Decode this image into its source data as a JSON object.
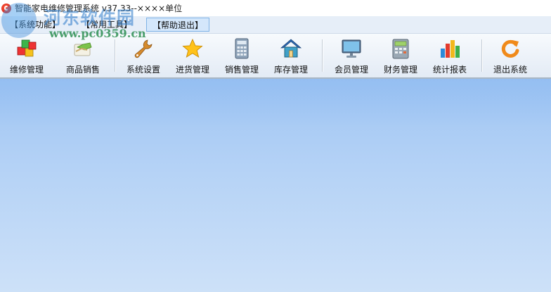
{
  "window": {
    "title": "智能家电维修管理系统 v37.33--××××单位"
  },
  "watermark": {
    "site_name": "河东软件园",
    "site_url": "www.pc0359.cn"
  },
  "menu": {
    "items": [
      "【系统功能】",
      "【常用工具】",
      "【帮助退出】"
    ]
  },
  "toolbar": {
    "buttons": [
      {
        "label": "维修管理",
        "icon": "colored-cubes-icon"
      },
      {
        "label": "商品销售",
        "icon": "handshake-icon"
      },
      {
        "label": "系统设置",
        "icon": "wrench-icon"
      },
      {
        "label": "进货管理",
        "icon": "star-icon"
      },
      {
        "label": "销售管理",
        "icon": "calculator-icon"
      },
      {
        "label": "库存管理",
        "icon": "house-icon"
      },
      {
        "label": "会员管理",
        "icon": "monitor-icon"
      },
      {
        "label": "财务管理",
        "icon": "cash-register-icon"
      },
      {
        "label": "统计报表",
        "icon": "bar-chart-icon"
      },
      {
        "label": "退出系统",
        "icon": "exit-refresh-icon"
      }
    ]
  },
  "colors": {
    "client_top": "#9fc5f3",
    "client_bottom": "#cde1f8",
    "menu_highlight": "#d4e7fb"
  }
}
